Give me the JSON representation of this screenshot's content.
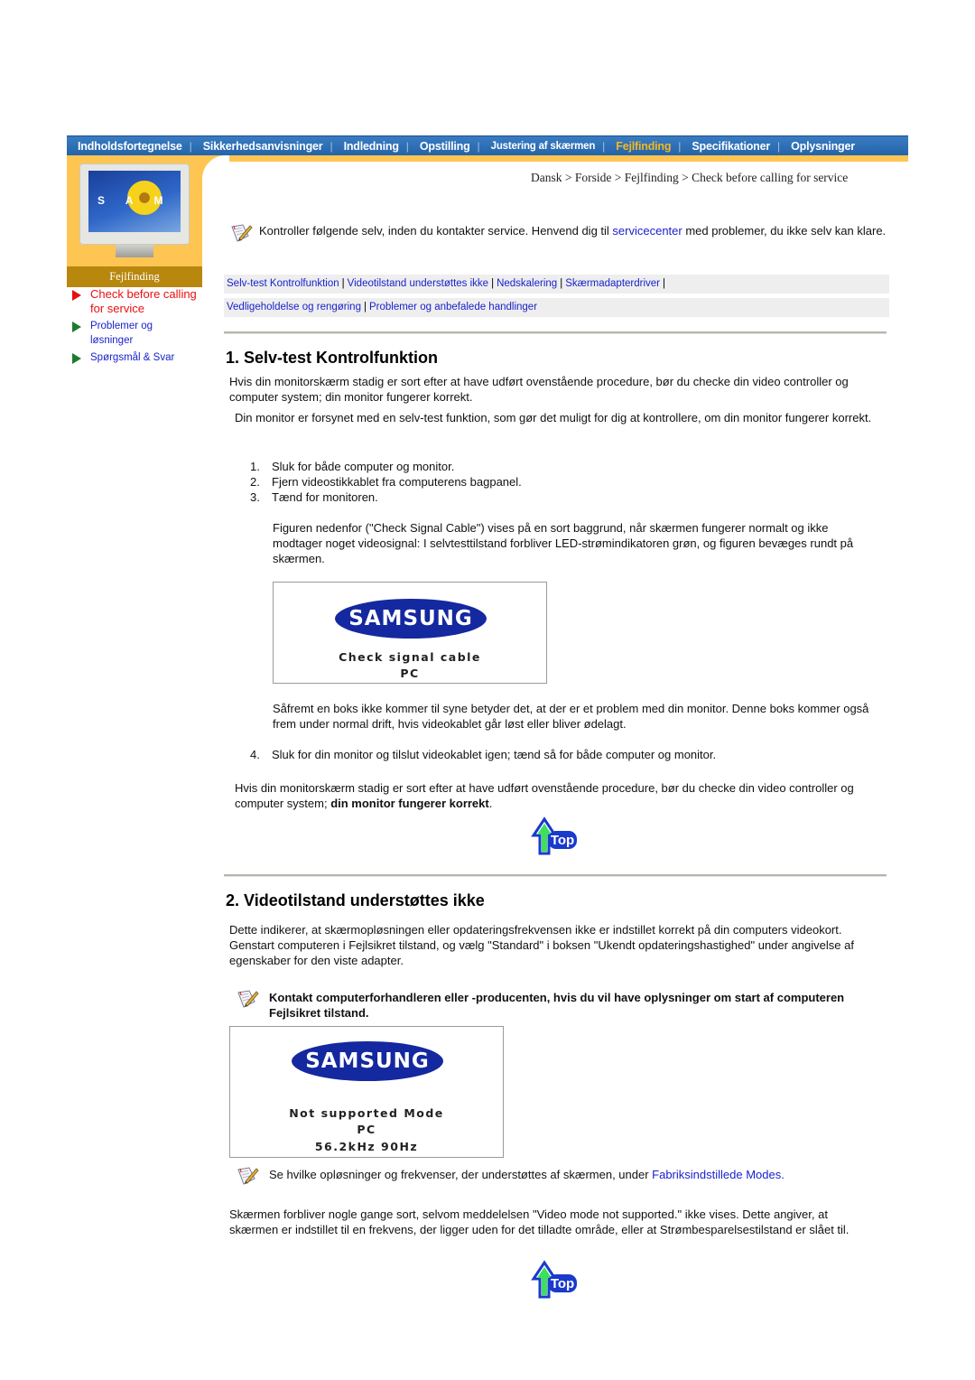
{
  "topnav": {
    "items": [
      {
        "label": "Indholdsfortegnelse",
        "active": false
      },
      {
        "label": "Sikkerhedsanvisninger",
        "active": false
      },
      {
        "label": "Indledning",
        "active": false
      },
      {
        "label": "Opstilling",
        "active": false
      },
      {
        "label": "Justering af skærmen",
        "active": false
      },
      {
        "label": "Fejlfinding",
        "active": true
      },
      {
        "label": "Specifikationer",
        "active": false
      },
      {
        "label": "Oplysninger",
        "active": false
      }
    ],
    "separator": "|",
    "active_color": "#f5b820"
  },
  "sidebar": {
    "section_label": "Fejlfinding",
    "monitor_screen_letters": "S A M",
    "items": [
      {
        "label": "Check before calling for service",
        "active": true
      },
      {
        "label": "Problemer og løsninger",
        "active": false
      },
      {
        "label": "Spørgsmål & Svar",
        "active": false
      }
    ]
  },
  "breadcrumb": {
    "items": [
      "Dansk",
      "Forside",
      "Fejlfinding",
      "Check before calling for service"
    ],
    "separator": " > "
  },
  "intro": {
    "icon": "note-pencil-icon",
    "text_before": "Kontroller følgende selv, inden du kontakter service. Henvend dig til ",
    "link": "servicecenter",
    "text_after": " med problemer, du ikke selv kan klare."
  },
  "linkbars": {
    "row1": [
      "Selv-test Kontrolfunktion",
      "Videotilstand understøttes ikke",
      "Nedskalering",
      "Skærmadapterdriver"
    ],
    "row2": [
      "Vedligeholdelse og rengøring",
      "Problemer og anbefalede handlinger"
    ],
    "separator": "|"
  },
  "section1": {
    "title": "1. Selv-test Kontrolfunktion",
    "p1": "Hvis din monitorskærm stadig er sort efter at have udført ovenstående procedure, bør du checke din video controller og computer system; din monitor fungerer korrekt.",
    "p2": "Din monitor er forsynet med en selv-test funktion, som gør det muligt for dig at kontrollere, om din monitor fungerer korrekt.",
    "steps": [
      {
        "num": "1.",
        "text": "Sluk for både computer og monitor."
      },
      {
        "num": "2.",
        "text": "Fjern videostikkablet fra computerens bagpanel."
      },
      {
        "num": "3.",
        "text": "Tænd for monitoren."
      }
    ],
    "figure_desc": "Figuren nedenfor (\"Check Signal Cable\") vises på en sort baggrund, når skærmen fungerer normalt og ikke modtager noget videosignal: I selvtesttilstand forbliver LED-strømindikatoren grøn, og figuren bevæges rundt på skærmen.",
    "osd": {
      "brand": "SAMSUNG",
      "line1": "Check signal cable",
      "line2": "PC"
    },
    "after_figure": "Såfremt en boks ikke kommer til syne betyder det, at der er et problem med din monitor. Denne boks kommer også frem under normal drift, hvis videokablet går løst eller bliver ødelagt.",
    "step4": {
      "num": "4.",
      "text": "Sluk for din monitor og tilslut videokablet igen; tænd så for både computer og monitor."
    },
    "closing_before": "Hvis din monitorskærm stadig er sort efter at have udført ovenstående procedure, bør du checke din video controller og computer system; ",
    "closing_bold": "din monitor fungerer korrekt",
    "closing_after": "."
  },
  "section2": {
    "title": "2. Videotilstand understøttes ikke",
    "p1": "Dette indikerer, at skærmopløsningen eller opdateringsfrekvensen ikke er indstillet korrekt på din computers videokort. Genstart computeren i Fejlsikret tilstand, og vælg \"Standard\" i boksen \"Ukendt opdateringshastighed\" under angivelse af egenskaber for den viste adapter.",
    "note1": "Kontakt computerforhandleren eller -producenten, hvis du vil have oplysninger om start af computeren Fejlsikret tilstand.",
    "osd": {
      "brand": "SAMSUNG",
      "line1": "Not supported Mode",
      "line2": "PC",
      "line3": "56.2kHz 90Hz"
    },
    "note2_before": "Se hvilke opløsninger og frekvenser, der understøttes af skærmen, under ",
    "note2_link": "Fabriksindstillede Modes.",
    "p2": "Skærmen forbliver nogle gange sort, selvom meddelelsen \"Video mode not supported.\" ikke vises. Dette angiver, at skærmen er indstillet til en frekvens, der ligger uden for det tilladte område, eller at Strømbesparelsestilstand er slået til."
  },
  "top_button": {
    "label": "Top"
  },
  "colors": {
    "nav_blue": "#2263a8",
    "accent_orange": "#fec552",
    "section_gold": "#b8870e",
    "link_blue": "#1a22cc",
    "active_red": "#e81010",
    "bullet_green": "#1c7c2c",
    "samsung_blue": "#1428a0"
  }
}
